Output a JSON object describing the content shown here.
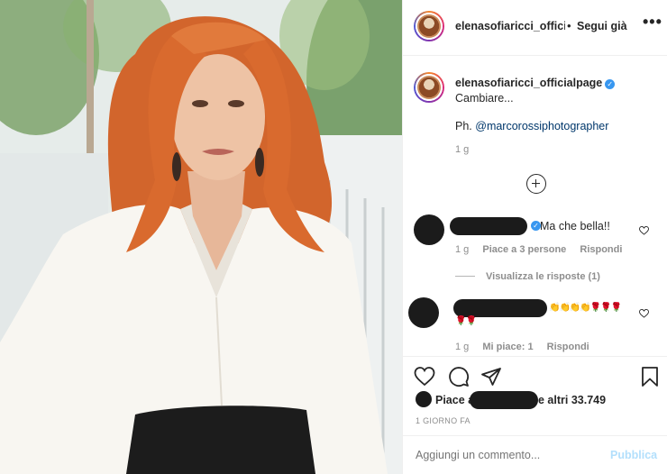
{
  "post": {
    "photo_description_icon": "portrait-photo",
    "author": "elenasofiaricci_official",
    "header_separator": "•",
    "follow_label": "Segui già",
    "more_icon": "more-horizontal-icon",
    "more_label": "•••"
  },
  "caption": {
    "author": "elenasofiaricci_officialpage",
    "verified_label": "✓",
    "text": "Cambiare...",
    "credit_prefix": "Ph.",
    "credit_mention": "@marcorossiphotographer",
    "time": "1 g"
  },
  "load_more_icon": "plus-circle-icon",
  "comments": [
    {
      "text": "Ma che bella!!",
      "time": "1 g",
      "likes": "Piace a 3 persone",
      "reply": "Rispondi",
      "view_replies": "Visualizza le risposte (1)"
    },
    {
      "emoji_line1": "👏👏👏👏🌹🌹🌹",
      "emoji_line2": "🌹🌹",
      "time": "1 g",
      "likes": "Mi piace: 1",
      "reply": "Rispondi"
    }
  ],
  "likes": {
    "prefix": "Piace a",
    "suffix": "e altri 33.749"
  },
  "post_time": "1 GIORNO FA",
  "comment_box": {
    "placeholder": "Aggiungi un commento...",
    "publish": "Pubblica"
  },
  "colors": {
    "link": "#00376b",
    "verified": "#3897f0",
    "publish_disabled": "#b2dffc",
    "muted": "#8e8e8e"
  }
}
